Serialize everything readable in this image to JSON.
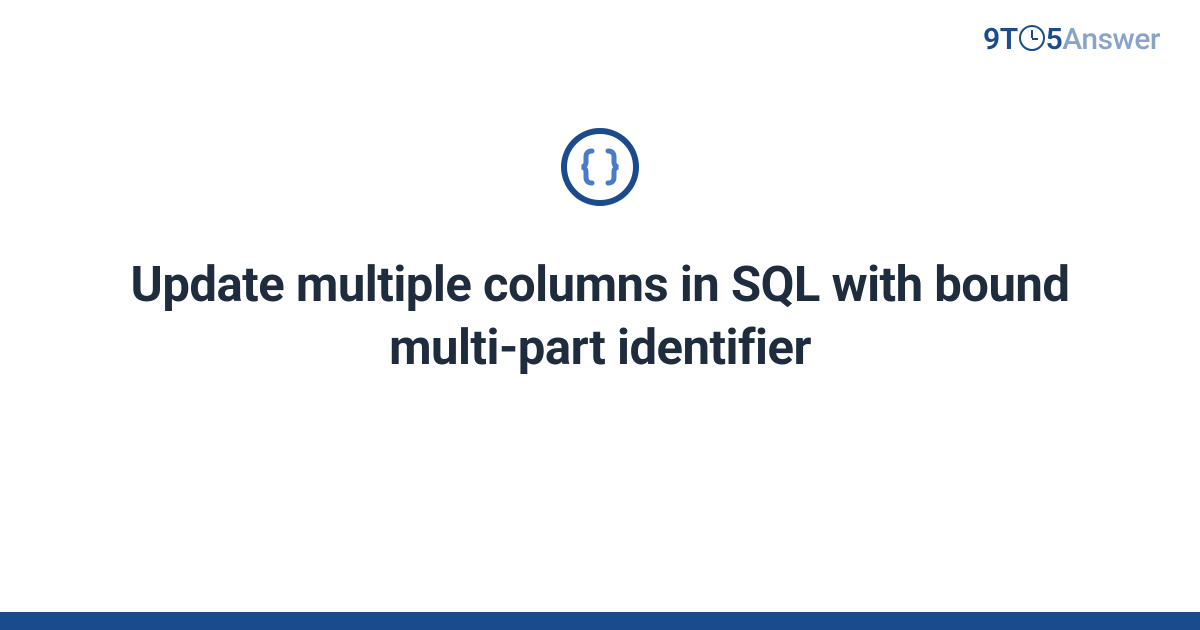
{
  "brand": {
    "prefix_nine": "9",
    "t": "T",
    "five": "5",
    "answer": "Answer"
  },
  "icon": {
    "name": "code-braces-icon"
  },
  "title": "Update multiple columns in SQL with bound multi-part identifier",
  "colors": {
    "primary": "#1a4b8c",
    "muted": "#8aa4c8",
    "text": "#1f2c3d",
    "icon_brace": "#4a7bc8"
  }
}
